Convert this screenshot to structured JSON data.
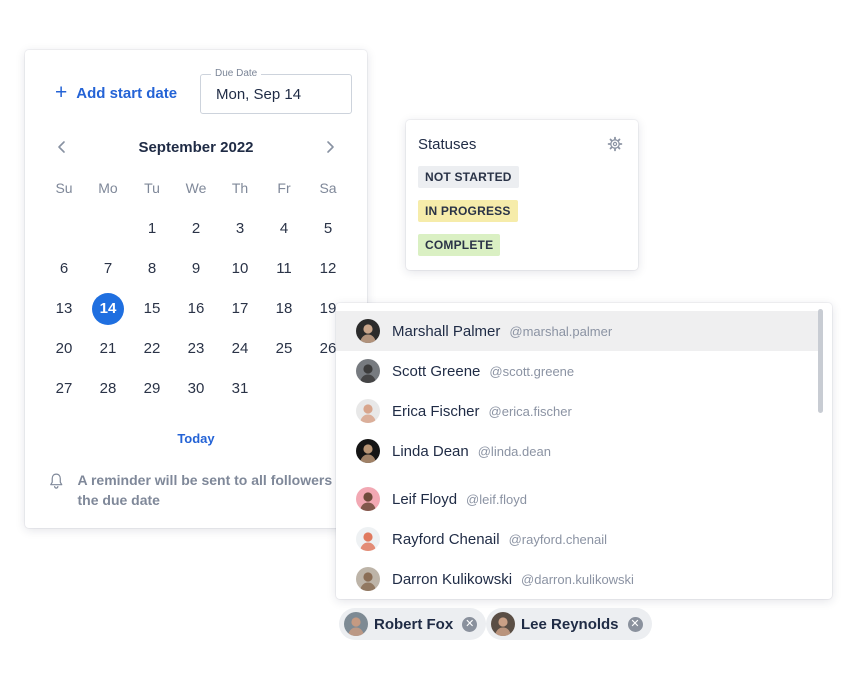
{
  "calendar": {
    "add_start_label": "Add start date",
    "due_label": "Due Date",
    "due_value": "Mon, Sep 14",
    "month_title": "September 2022",
    "weekdays": [
      "Su",
      "Mo",
      "Tu",
      "We",
      "Th",
      "Fr",
      "Sa"
    ],
    "weeks": [
      [
        "",
        "",
        "1",
        "2",
        "3",
        "4",
        "5"
      ],
      [
        "6",
        "7",
        "8",
        "9",
        "10",
        "11",
        "12"
      ],
      [
        "13",
        "14",
        "15",
        "16",
        "17",
        "18",
        "19"
      ],
      [
        "20",
        "21",
        "22",
        "23",
        "24",
        "25",
        "26"
      ],
      [
        "27",
        "28",
        "29",
        "30",
        "31",
        "",
        ""
      ]
    ],
    "selected_day": "14",
    "today_label": "Today",
    "reminder_text": "A reminder will be sent to all followers on the due date",
    "selected_color": "#1f6fe0",
    "accent_color": "#2463d6"
  },
  "statuses": {
    "title": "Statuses",
    "items": [
      {
        "label": "NOT STARTED",
        "bg": "#eceef1",
        "fg": "#2a3347"
      },
      {
        "label": "IN PROGRESS",
        "bg": "#f6ecaa",
        "fg": "#2a3347"
      },
      {
        "label": "COMPLETE",
        "bg": "#daf0c3",
        "fg": "#2a3347"
      }
    ]
  },
  "people": [
    {
      "name": "Marshall Palmer",
      "handle": "@marshal.palmer",
      "avatar_bg": "#2b2b2b",
      "skin": "#c9a58a"
    },
    {
      "name": "Scott Greene",
      "handle": "@scott.greene",
      "avatar_bg": "#777b80",
      "skin": "#3c3c3c"
    },
    {
      "name": "Erica Fischer",
      "handle": "@erica.fischer",
      "avatar_bg": "#e8e8e8",
      "skin": "#d8a58c"
    },
    {
      "name": "Linda Dean",
      "handle": "@linda.dean",
      "avatar_bg": "#151515",
      "skin": "#b89474"
    },
    {
      "name": "Leif Floyd",
      "handle": "@leif.floyd",
      "avatar_bg": "#f2a8b3",
      "skin": "#6e4a3a"
    },
    {
      "name": "Rayford Chenail",
      "handle": "@rayford.chenail",
      "avatar_bg": "#eef1f3",
      "skin": "#e07a5f"
    },
    {
      "name": "Darron Kulikowski",
      "handle": "@darron.kulikowski",
      "avatar_bg": "#bdb4a8",
      "skin": "#8a6d55"
    }
  ],
  "chips": [
    {
      "name": "Robert Fox",
      "avatar_bg": "#7d8a94",
      "skin": "#c59a82"
    },
    {
      "name": "Lee Reynolds",
      "avatar_bg": "#5a4e45",
      "skin": "#caa086"
    }
  ],
  "icons": {
    "plus": "plus-icon",
    "prev": "chevron-left-icon",
    "next": "chevron-right-icon",
    "bell": "bell-icon",
    "gear": "gear-icon",
    "remove": "close-icon"
  }
}
